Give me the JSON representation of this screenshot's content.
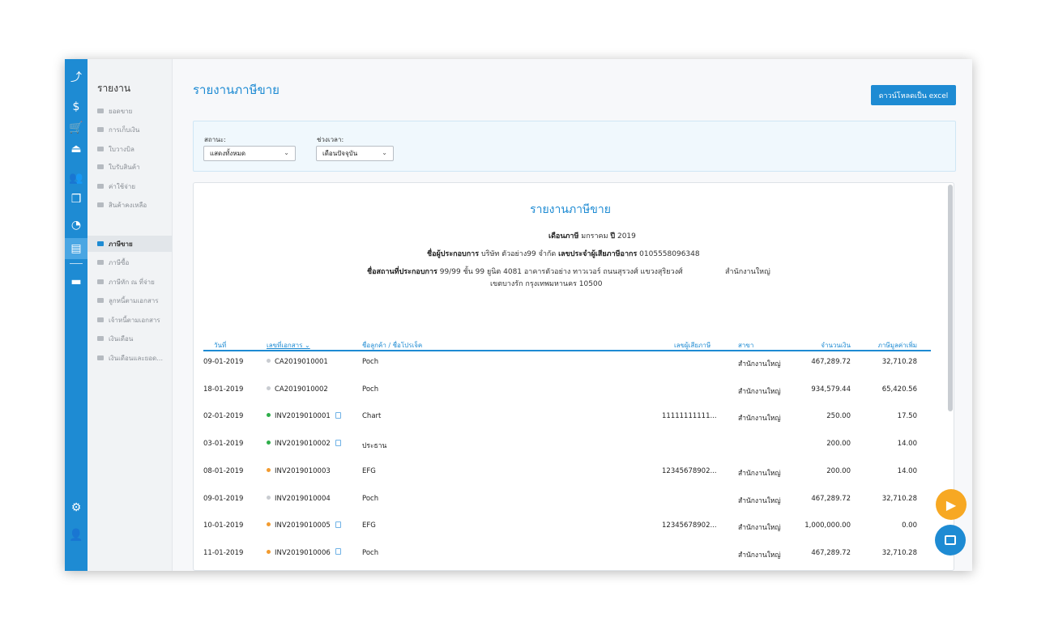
{
  "sidebar": {
    "title": "รายงาน",
    "items": [
      {
        "label": "ยอดขาย"
      },
      {
        "label": "การเก็บเงิน"
      },
      {
        "label": "ใบวางบิล"
      },
      {
        "label": "ใบรับสินค้า"
      },
      {
        "label": "ค่าใช้จ่าย"
      },
      {
        "label": "สินค้าคงเหลือ"
      },
      {
        "label": "ภาษีขาย",
        "active": true
      },
      {
        "label": "ภาษีซื้อ"
      },
      {
        "label": "ภาษีหัก ณ ที่จ่าย"
      },
      {
        "label": "ลูกหนี้ตามเอกสาร"
      },
      {
        "label": "เจ้าหนี้ตามเอกสาร"
      },
      {
        "label": "เงินเดือน"
      },
      {
        "label": "เงินเดือนและยอด..."
      }
    ]
  },
  "iconbar": {
    "icons": [
      "trend-icon",
      "dollar-icon",
      "cart-icon",
      "inbox-icon",
      "people-icon",
      "box-icon",
      "gauge-icon",
      "report-icon",
      "briefcase-icon",
      "gear-icon",
      "user-icon"
    ],
    "glyphs": [
      "⤴",
      "$",
      "🛒",
      "⏏",
      "👥",
      "❒",
      "◔",
      "▤",
      "▬",
      "⚙",
      "👤"
    ]
  },
  "header": {
    "title": "รายงานภาษีขาย",
    "download_label": "ดาวน์โหลดเป็น excel"
  },
  "filter": {
    "status_label": "สถานะ:",
    "status_value": "แสดงทั้งหมด",
    "period_label": "ช่วงเวลา:",
    "period_value": "เดือนปัจจุบัน"
  },
  "report": {
    "title": "รายงานภาษีขาย",
    "month_label": "เดือนภาษี",
    "month_value": "มกราคม",
    "year_label": "ปี",
    "year_value": "2019",
    "operator_label": "ชื่อผู้ประกอบการ",
    "operator_value": "บริษัท ตัวอย่าง99 จำกัด",
    "taxid_label": "เลขประจำผู้เสียภาษีอากร",
    "taxid_value": "0105558096348",
    "address_label": "ชื่อสถานที่ประกอบการ",
    "address_value": "99/99 ชั้น 99 ยูนิต 4081 อาคารตัวอย่าง ทาวเวอร์ ถนนสุรวงศ์ แขวงสุริยวงศ์",
    "address_value2": "เขตบางรัก กรุงเทพมหานคร 10500",
    "branch_value": "สำนักงานใหญ่"
  },
  "table": {
    "columns": [
      "วันที่",
      "เลขที่เอกสาร ⌄",
      "ชื่อลูกค้า / ชื่อโปรเจ็ค",
      "เลขผู้เสียภาษี",
      "สาขา",
      "จำนวนเงิน",
      "ภาษีมูลค่าเพิ่ม"
    ],
    "rows": [
      {
        "date": "09-01-2019",
        "doc": "CA2019010001",
        "status_color": "#c9ccd1",
        "has_file": false,
        "customer": "Poch",
        "taxid": "",
        "branch": "สำนักงานใหญ่",
        "amount": "467,289.72",
        "vat": "32,710.28"
      },
      {
        "date": "18-01-2019",
        "doc": "CA2019010002",
        "status_color": "#c9ccd1",
        "has_file": false,
        "customer": "Poch",
        "taxid": "",
        "branch": "สำนักงานใหญ่",
        "amount": "934,579.44",
        "vat": "65,420.56"
      },
      {
        "date": "02-01-2019",
        "doc": "INV2019010001",
        "status_color": "#2eae4a",
        "has_file": true,
        "customer": "Chart",
        "taxid": "11111111111...",
        "branch": "สำนักงานใหญ่",
        "amount": "250.00",
        "vat": "17.50"
      },
      {
        "date": "03-01-2019",
        "doc": "INV2019010002",
        "status_color": "#2eae4a",
        "has_file": true,
        "customer": "ประธาน",
        "taxid": "",
        "branch": "",
        "amount": "200.00",
        "vat": "14.00"
      },
      {
        "date": "08-01-2019",
        "doc": "INV2019010003",
        "status_color": "#f29b30",
        "has_file": false,
        "customer": "EFG",
        "taxid": "12345678902...",
        "branch": "สำนักงานใหญ่",
        "amount": "200.00",
        "vat": "14.00"
      },
      {
        "date": "09-01-2019",
        "doc": "INV2019010004",
        "status_color": "#c9ccd1",
        "has_file": false,
        "customer": "Poch",
        "taxid": "",
        "branch": "สำนักงานใหญ่",
        "amount": "467,289.72",
        "vat": "32,710.28"
      },
      {
        "date": "10-01-2019",
        "doc": "INV2019010005",
        "status_color": "#f29b30",
        "has_file": true,
        "customer": "EFG",
        "taxid": "12345678902...",
        "branch": "สำนักงานใหญ่",
        "amount": "1,000,000.00",
        "vat": "0.00"
      },
      {
        "date": "11-01-2019",
        "doc": "INV2019010006",
        "status_color": "#f29b30",
        "has_file": true,
        "customer": "Poch",
        "taxid": "",
        "branch": "สำนักงานใหญ่",
        "amount": "467,289.72",
        "vat": "32,710.28"
      }
    ]
  },
  "fabs": {
    "play_color": "#f7a823",
    "chat_color": "#1e8bd3"
  }
}
